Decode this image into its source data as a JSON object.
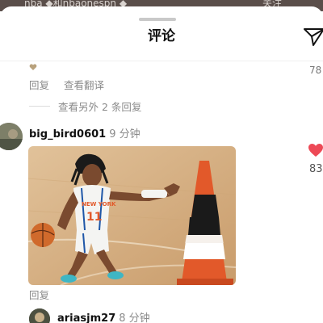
{
  "background": {
    "feed_text": "nba ◆和nbaonespn ◆",
    "follow_text": "关注"
  },
  "header": {
    "title": "评论"
  },
  "previous_comment": {
    "likes": "78",
    "reply_label": "回复",
    "translate_label": "查看翻译",
    "more_replies_label": "查看另外 2 条回复"
  },
  "comment": {
    "username": "big_bird0601",
    "time": "9 分钟",
    "likes": "83",
    "liked": true,
    "reply_label": "回复",
    "image_player_number": "11",
    "image_jersey_text": "NEW YORK"
  },
  "next_comment": {
    "username": "ariasjm27",
    "time": "8 分钟"
  },
  "colors": {
    "like_red": "#ed4956",
    "secondary_text": "#8a8a8a",
    "court": "#d8b48a",
    "cone_orange": "#e2592a"
  }
}
